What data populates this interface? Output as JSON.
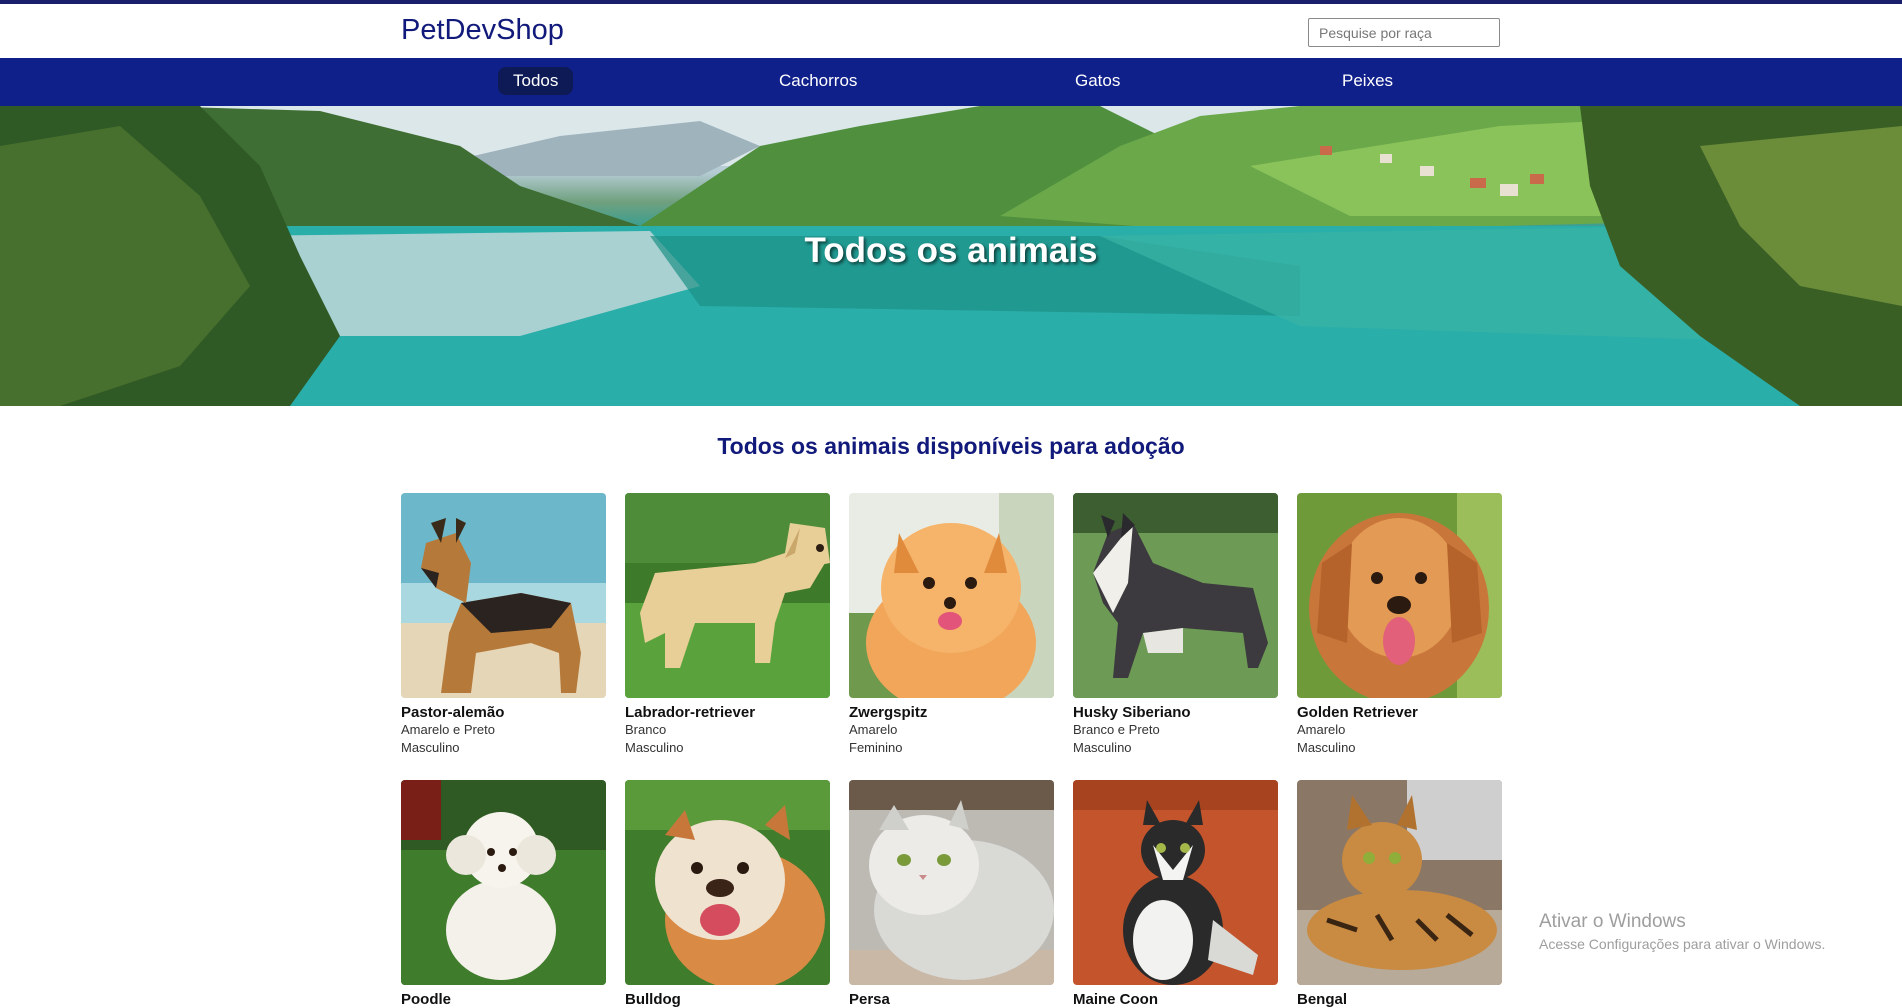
{
  "header": {
    "brand": "PetDevShop",
    "search_placeholder": "Pesquise por raça"
  },
  "nav": {
    "items": [
      {
        "label": "Todos",
        "active": true
      },
      {
        "label": "Cachorros",
        "active": false
      },
      {
        "label": "Gatos",
        "active": false
      },
      {
        "label": "Peixes",
        "active": false
      }
    ]
  },
  "hero": {
    "title": "Todos os animais"
  },
  "main": {
    "title": "Todos os animais disponíveis para adoção",
    "animals": [
      {
        "name": "Pastor-alemão",
        "color": "Amarelo e Preto",
        "sex": "Masculino",
        "photo_icon": "german-shepherd-photo"
      },
      {
        "name": "Labrador-retriever",
        "color": "Branco",
        "sex": "Masculino",
        "photo_icon": "labrador-photo"
      },
      {
        "name": "Zwergspitz",
        "color": "Amarelo",
        "sex": "Feminino",
        "photo_icon": "pomeranian-photo"
      },
      {
        "name": "Husky Siberiano",
        "color": "Branco e Preto",
        "sex": "Masculino",
        "photo_icon": "husky-photo"
      },
      {
        "name": "Golden Retriever",
        "color": "Amarelo",
        "sex": "Masculino",
        "photo_icon": "golden-retriever-photo"
      },
      {
        "name": "Poodle",
        "photo_icon": "poodle-photo"
      },
      {
        "name": "Bulldog",
        "photo_icon": "bulldog-photo"
      },
      {
        "name": "Persa",
        "photo_icon": "persian-cat-photo"
      },
      {
        "name": "Maine Coon",
        "photo_icon": "maine-coon-photo"
      },
      {
        "name": "Bengal",
        "photo_icon": "bengal-cat-photo"
      }
    ]
  },
  "watermark": {
    "title": "Ativar o Windows",
    "subtitle": "Acesse Configurações para ativar o Windows."
  },
  "colors": {
    "brand": "#111a7a",
    "nav_bg": "#10208a",
    "nav_active_bg": "#0d1a56"
  }
}
